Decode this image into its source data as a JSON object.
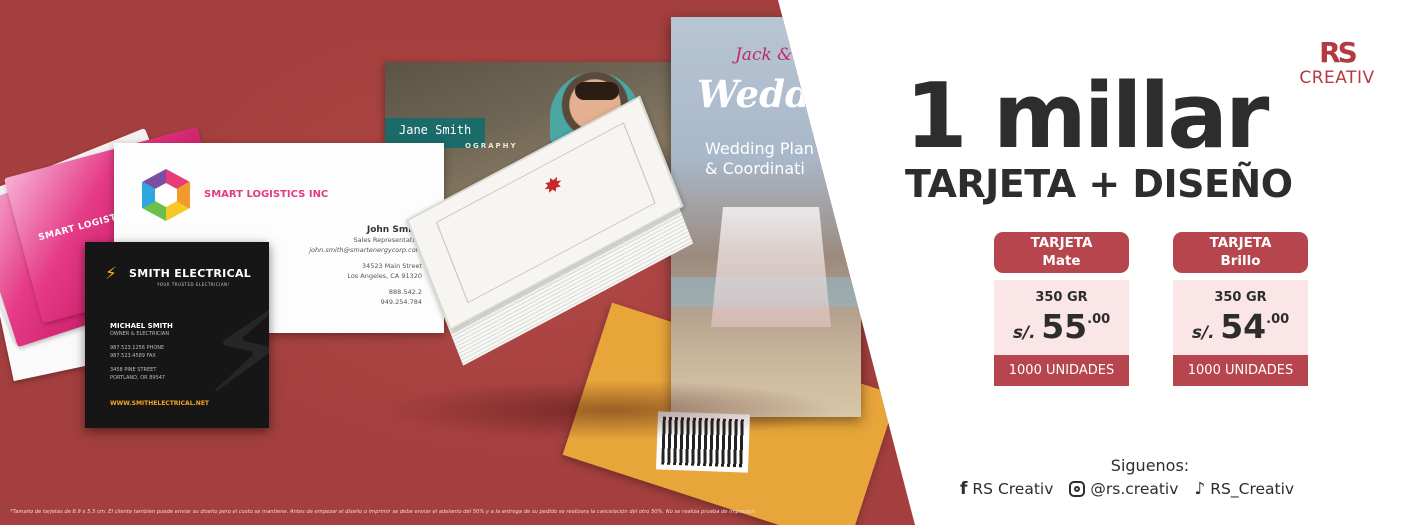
{
  "brand": {
    "mark": "RS",
    "name": "CREATIV",
    "color": "#b23a40"
  },
  "headline": {
    "main": "1 millar",
    "sub": "TARJETA + DISEÑO"
  },
  "products": [
    {
      "title_line1": "TARJETA",
      "title_line2": "Mate",
      "weight": "350 GR",
      "currency": "s/.",
      "price_int": "55",
      "price_dec": ".00",
      "units": "1000 UNIDADES"
    },
    {
      "title_line1": "TARJETA",
      "title_line2": "Brillo",
      "weight": "350 GR",
      "currency": "s/.",
      "price_int": "54",
      "price_dec": ".00",
      "units": "1000 UNIDADES"
    }
  ],
  "social": {
    "label": "Siguenos:",
    "facebook": "RS Creativ",
    "instagram": "@rs.creativ",
    "tiktok": "RS_Creativ"
  },
  "mockups": {
    "pink_card_text": "SMART LOGISTICS",
    "smart_company": "SMART LOGISTICS INC",
    "smart_name": "John Smith",
    "smart_role": "Sales Representative",
    "smart_email": "john.smith@smartenergycorp.com",
    "smart_addr1": "34523 Main Street",
    "smart_addr2": "Los Angeles, CA 91320",
    "smart_phone1": "888.542.2",
    "smart_phone2": "949.254.784",
    "elec_title": "SMITH ELECTRICAL",
    "elec_tagline": "YOUR TRUSTED ELECTRICIAN!",
    "elec_name": "MICHAEL SMITH",
    "elec_role": "OWNER & ELECTRICIAN",
    "elec_phone": "987.523.1256 PHONE",
    "elec_fax": "987.523.4589 FAX",
    "elec_addr1": "3458 PINE STREET",
    "elec_addr2": "PORTLAND, OR 89547",
    "elec_web": "WWW.SMITHELECTRICAL.NET",
    "photo_name": "Jane Smith",
    "photo_sub": "OGRAPHY",
    "wedding_names": "Jack & J",
    "wedding_title": "Wedd",
    "wedding_line1": "Wedding Plan",
    "wedding_line2": "& Coordinati"
  },
  "disclaimer": "*Tamaño de tarjetas de 8.9 x 5.5 cm. El cliente tambien puede enviar su diseño pero el costo se mantiene. Antes de empezar el diseño o imprimir se debe enviar el adelanto del 50% y a la entrega de su pedido se realizara la cancelación del otro 50%. No se realiza prueba de impresión.",
  "colors": {
    "background_red": "#a33f3e",
    "accent": "#b6454d",
    "price_box": "#fbe6e7",
    "text_dark": "#2d2d2d"
  }
}
